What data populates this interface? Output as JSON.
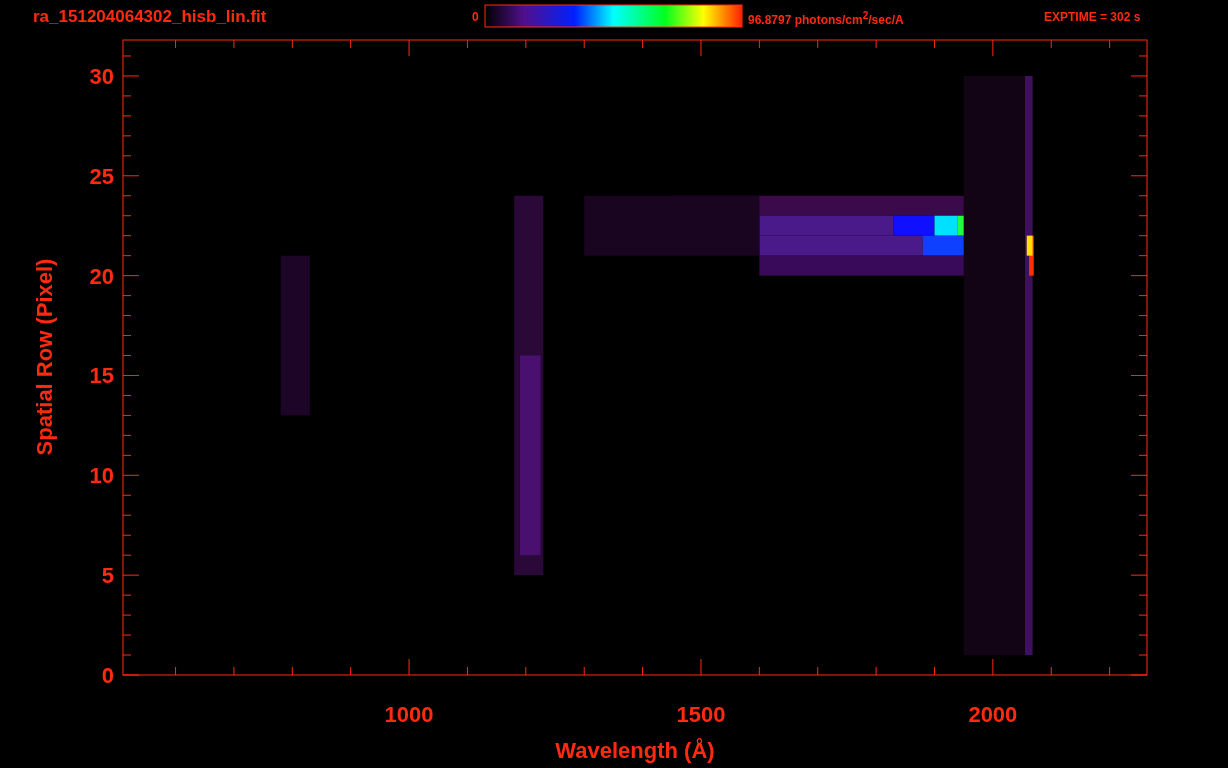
{
  "header": {
    "file_name": "ra_151204064302_hisb_lin.fit",
    "colorbar": {
      "min_label": "0",
      "max_label": "96.8797 photons/cm$^{2}$/sec/A"
    },
    "exposure": "EXPTIME = 302 s"
  },
  "plot": {
    "x_axis": {
      "label": "Wavelength (Å)",
      "tick_labels": [
        "1000",
        "1500",
        "2000"
      ]
    },
    "y_axis": {
      "label": "Spatial Row (Pixel)",
      "tick_labels": [
        "30",
        "25",
        "20",
        "15",
        "10",
        "5",
        "0"
      ]
    }
  }
}
